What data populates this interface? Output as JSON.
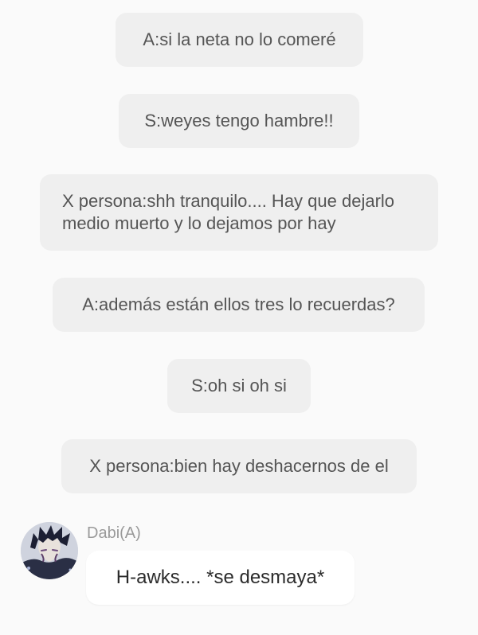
{
  "narrations": [
    "A:si la neta no lo comeré",
    "S:weyes tengo hambre!!",
    "X persona:shh tranquilo.... Hay que dejarlo medio muerto y lo dejamos por hay",
    "A:además están ellos tres lo recuerdas?",
    "S:oh si oh si",
    "X persona:bien hay deshacernos de el"
  ],
  "message": {
    "sender": "Dabi(A)",
    "avatar_icon": "character-avatar",
    "text": "H-awks.... *se desmaya*"
  },
  "colors": {
    "background": "#fafafa",
    "narration_bubble": "#efefef",
    "message_bubble": "#ffffff",
    "sender_name": "#9a9a9a"
  }
}
